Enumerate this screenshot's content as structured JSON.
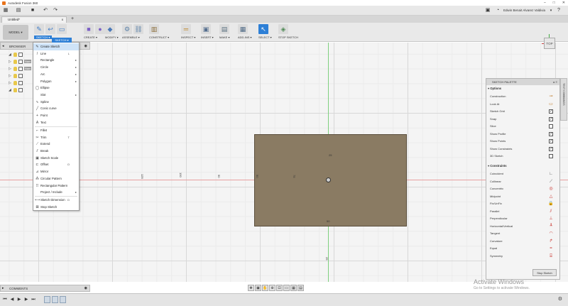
{
  "window": {
    "title": "Autodesk Fusion 360",
    "minimize": "–",
    "maximize": "□",
    "close": "✕"
  },
  "quickbar": {
    "user": "Edwin Benait Alvarez Valdivia",
    "user_caret": "▾",
    "help": "?"
  },
  "tabs": {
    "doc_name": "Untitled*",
    "close": "x",
    "new_tab": "+"
  },
  "workspace": {
    "label": "MODEL ▾"
  },
  "toolbar": [
    {
      "label": "SKETCH ▾",
      "icons": [
        "✎",
        "↩",
        "▭"
      ]
    },
    {
      "label": "CREATE ▾",
      "icons": [
        "■",
        "●"
      ]
    },
    {
      "label": "MODIFY ▾",
      "icons": [
        "◆"
      ]
    },
    {
      "label": "ASSEMBLE ▾",
      "icons": [
        "⚙",
        "⛓"
      ]
    },
    {
      "label": "CONSTRUCT ▾",
      "icons": [
        "▥"
      ]
    },
    {
      "label": "INSPECT ▾",
      "icons": [
        "═"
      ]
    },
    {
      "label": "INSERT ▾",
      "icons": [
        "▣"
      ]
    },
    {
      "label": "MAKE ▾",
      "icons": [
        "▤"
      ]
    },
    {
      "label": "ADD-INS ▾",
      "icons": [
        "▦"
      ]
    },
    {
      "label": "SELECT ▾",
      "icons": [
        "↖"
      ]
    },
    {
      "label": "STOP SKETCH",
      "icons": [
        "◈"
      ]
    }
  ],
  "browser": {
    "label": "BROWSER",
    "pin": "◉",
    "rows": [
      {
        "name": "",
        "tri": "◢"
      },
      {
        "name": "Nam",
        "tri": "▷"
      },
      {
        "name": "Nam",
        "tri": "▷"
      },
      {
        "name": "",
        "tri": "▷"
      },
      {
        "name": "",
        "tri": "▷"
      },
      {
        "name": "",
        "tri": "◢"
      }
    ]
  },
  "sketch_menu": {
    "header": "SKETCH ▾",
    "items": [
      {
        "icon": "✎",
        "label": "Create Sketch",
        "arrow": "",
        "key": "",
        "hl": true
      },
      {
        "icon": "/",
        "label": "Line",
        "arrow": "",
        "key": "L"
      },
      {
        "icon": "",
        "label": "Rectangle",
        "arrow": "▸",
        "key": ""
      },
      {
        "icon": "",
        "label": "Circle",
        "arrow": "▸",
        "key": ""
      },
      {
        "icon": "",
        "label": "Arc",
        "arrow": "▸",
        "key": ""
      },
      {
        "icon": "",
        "label": "Polygon",
        "arrow": "▸",
        "key": ""
      },
      {
        "icon": "◯",
        "label": "Ellipse",
        "arrow": "",
        "key": ""
      },
      {
        "icon": "",
        "label": "Slot",
        "arrow": "▸",
        "key": ""
      },
      {
        "icon": "∿",
        "label": "Spline",
        "arrow": "",
        "key": ""
      },
      {
        "icon": "╱",
        "label": "Conic curve",
        "arrow": "",
        "key": ""
      },
      {
        "icon": "+",
        "label": "Point",
        "arrow": "",
        "key": ""
      },
      {
        "icon": "A",
        "label": "Text",
        "arrow": "",
        "key": ""
      },
      {
        "icon": "⌐",
        "label": "Fillet",
        "arrow": "",
        "key": ""
      },
      {
        "icon": "✂",
        "label": "Trim",
        "arrow": "",
        "key": "T"
      },
      {
        "icon": "⟋",
        "label": "Extend",
        "arrow": "",
        "key": ""
      },
      {
        "icon": "⫽",
        "label": "Break",
        "arrow": "",
        "key": ""
      },
      {
        "icon": "▣",
        "label": "Sketch Scale",
        "arrow": "",
        "key": ""
      },
      {
        "icon": "⊏",
        "label": "Offset",
        "arrow": "",
        "key": "O"
      },
      {
        "icon": "⊿",
        "label": "Mirror",
        "arrow": "",
        "key": ""
      },
      {
        "icon": "⁂",
        "label": "Circular Pattern",
        "arrow": "",
        "key": ""
      },
      {
        "icon": "⠿",
        "label": "Rectangular Pattern",
        "arrow": "",
        "key": ""
      },
      {
        "icon": "",
        "label": "Project / Include",
        "arrow": "▸",
        "key": ""
      },
      {
        "icon": "⟷",
        "label": "Sketch Dimension",
        "arrow": "",
        "key": "D"
      },
      {
        "icon": "⊠",
        "label": "Stop Sketch",
        "arrow": "",
        "key": ""
      }
    ]
  },
  "canvas": {
    "dims": [
      "125",
      "100",
      "50",
      "50",
      "75",
      "25",
      "50",
      "25"
    ]
  },
  "viewcube": {
    "face": "TOP"
  },
  "palette": {
    "title": "SKETCH PALETTE",
    "controls": "▸ ≡",
    "options_header": "▾ Options",
    "options": [
      {
        "label": "Construction",
        "icon": "⊸",
        "type": "icon"
      },
      {
        "label": "Look At",
        "icon": "▭",
        "type": "icon"
      },
      {
        "label": "Sketch Grid",
        "icon": "✓",
        "type": "check"
      },
      {
        "label": "Snap",
        "icon": "✓",
        "type": "check"
      },
      {
        "label": "Slice",
        "icon": "",
        "type": "check"
      },
      {
        "label": "Show Profile",
        "icon": "✓",
        "type": "check"
      },
      {
        "label": "Show Points",
        "icon": "✓",
        "type": "check"
      },
      {
        "label": "Show Constraints",
        "icon": "✓",
        "type": "check"
      },
      {
        "label": "3D Sketch",
        "icon": "",
        "type": "check"
      }
    ],
    "constraints_header": "▾ Constraints",
    "constraints": [
      {
        "label": "Coincident",
        "icon": "∟",
        "color": "#444444"
      },
      {
        "label": "Collinear",
        "icon": "⟋",
        "color": "#444444"
      },
      {
        "label": "Concentric",
        "icon": "◎",
        "color": "#c8322b"
      },
      {
        "label": "Midpoint",
        "icon": "△",
        "color": "#c8322b"
      },
      {
        "label": "Fix/UnFix",
        "icon": "🔒",
        "color": "#c8322b"
      },
      {
        "label": "Parallel",
        "icon": "⫽",
        "color": "#c8322b"
      },
      {
        "label": "Perpendicular",
        "icon": "⊥",
        "color": "#c8322b"
      },
      {
        "label": "Horizontal/Vertical",
        "icon": "┸",
        "color": "#c8322b"
      },
      {
        "label": "Tangent",
        "icon": "◠",
        "color": "#c8322b"
      },
      {
        "label": "Curvature",
        "icon": "↱",
        "color": "#c8322b"
      },
      {
        "label": "Equal",
        "icon": "=",
        "color": "#c8322b"
      },
      {
        "label": "Symmetry",
        "icon": "⌸",
        "color": "#c8322b"
      }
    ],
    "stop_button": "Stop Sketch"
  },
  "side_tab": "TEXT COMMANDS",
  "comments": {
    "label": "COMMENTS",
    "pin": "◉"
  },
  "navbar": [
    "✥",
    "▣",
    "✋",
    "⊕",
    "⊡",
    "▭",
    "▦",
    "▤"
  ],
  "timeline": {
    "buttons": [
      "⏮",
      "◀",
      "▶",
      "▶",
      "⏭"
    ],
    "gear": "⚙"
  },
  "watermark": {
    "line1": "Activate Windows",
    "line2": "Go to Settings to activate Windows."
  },
  "colors": {
    "accent": "#2d7fd6",
    "profile": "#8a7b63",
    "axis_x": "#e8a0a0",
    "axis_y": "#7fcf7f"
  }
}
